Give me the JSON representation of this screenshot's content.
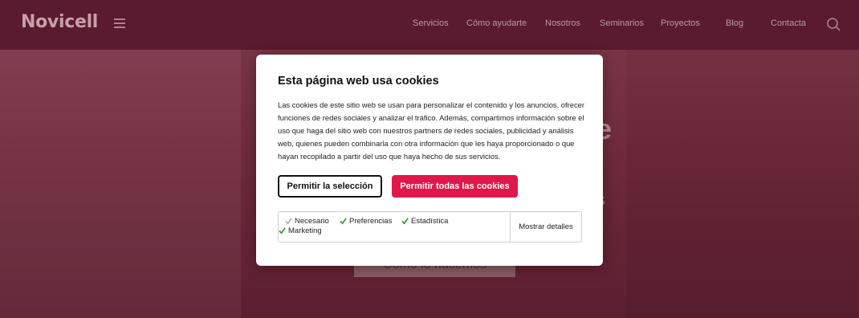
{
  "header": {
    "logo": "Novicell",
    "nav": [
      "Servicios",
      "Cómo ayudarte",
      "Nosotros",
      "Seminarios",
      "Proyectos",
      "Blog",
      "Contacta"
    ]
  },
  "hero": {
    "heading_fragment": "e",
    "subtitle_fragment": "s",
    "cta_label": "Cómo lo hacemos"
  },
  "cookie_dialog": {
    "title": "Esta página web usa cookies",
    "body": "Las cookies de este sitio web se usan para personalizar el contenido y los anuncios, ofrecer funciones de redes sociales y analizar el tráfico. Además, compartimos información sobre el uso que haga del sitio web con nuestros partners de redes sociales, publicidad y análisis web, quienes pueden combinarla con otra información que les haya proporcionado o que hayan recopilado a partir del uso que haya hecho de sus servicios.",
    "allow_selection_label": "Permitir la selección",
    "allow_all_label": "Permitir todas las cookies",
    "preferences": [
      {
        "label": "Necesario",
        "checked": true
      },
      {
        "label": "Preferencias",
        "checked": true
      },
      {
        "label": "Estadística",
        "checked": true
      },
      {
        "label": "Marketing",
        "checked": true
      }
    ],
    "show_details_label": "Mostrar detalles"
  },
  "colors": {
    "accent": "#e0184a",
    "check_green": "#2a9a2a",
    "check_disabled": "#b0b0b0",
    "header_bg": "#5a1a30",
    "overlay_bg": "#6e2a3a"
  }
}
